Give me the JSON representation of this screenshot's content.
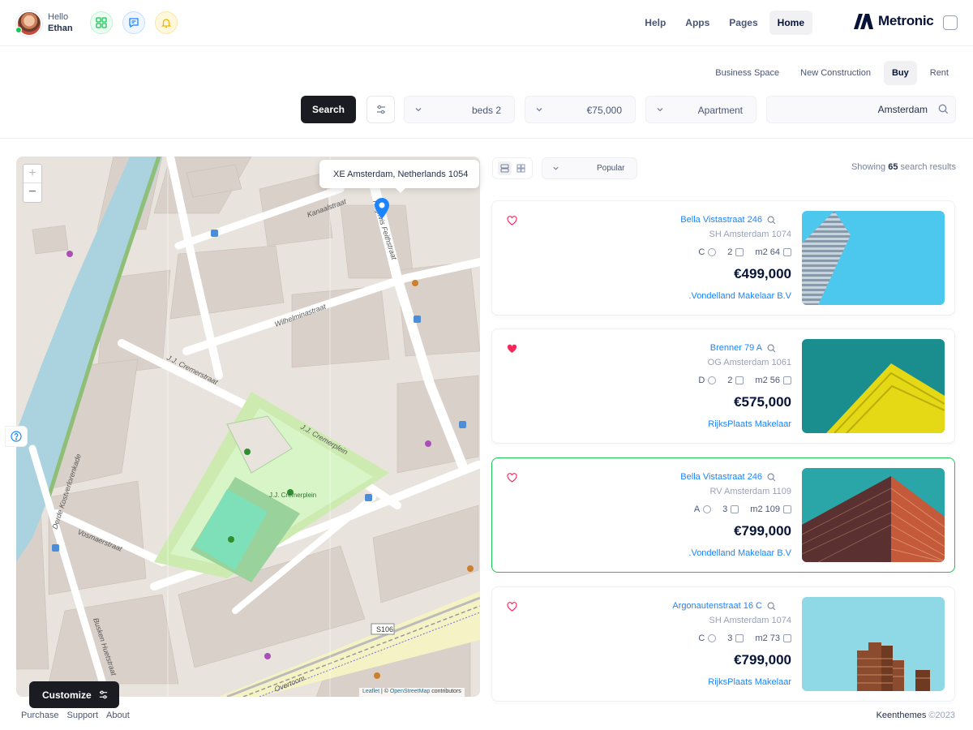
{
  "header": {
    "greeting": "Hello",
    "user_name": "Ethan",
    "nav": [
      "Help",
      "Apps",
      "Pages",
      "Home"
    ],
    "active_nav": "Home",
    "brand": "Metronic",
    "icons": [
      "apps-icon",
      "chat-icon",
      "notification-bell-icon"
    ],
    "icon_colors": [
      "#17c653",
      "#1b84ff",
      "#f6b100"
    ]
  },
  "toolbar": {
    "tabs": [
      "Business Space",
      "New Construction",
      "Buy",
      "Rent"
    ],
    "active_tab": "Buy",
    "search_label": "Search",
    "beds": "beds 2",
    "price": "€75,000",
    "type": "Apartment",
    "location": "Amsterdam"
  },
  "map": {
    "zoom_in": "+",
    "zoom_out": "−",
    "popup": "XE Amsterdam, Netherlands 1054",
    "attribution_leaflet": "Leaflet",
    "attribution_sep": " | © ",
    "attribution_osm": "OpenStreetMap",
    "attribution_rest": " contributors",
    "labels": {
      "kanaalstraat": "Kanaalstraat",
      "wilhelminastraat": "Wilhelminastraat",
      "cremerstraat": "J.J. Cremerstraat",
      "cremerplein": "J.J. Cremerplein",
      "cremerplein_park": "J.J. Cremerplein",
      "vosmaerstraat": "Vosmaerstraat",
      "overtoom": "Overtoom",
      "rhijnvis": "Rhijnvis Feithstraat",
      "kostverloren": "Derde Kostverlorenkade",
      "s106": "S106",
      "busken": "Busken Huetstraat"
    }
  },
  "list": {
    "sort": "Popular",
    "showing_prefix": "Showing",
    "count": "65",
    "showing_suffix": "search results",
    "cards": [
      {
        "title": "Bella Vistastraat 246",
        "addr": "SH Amsterdam 1074",
        "label": "C",
        "beds": "2",
        "area": "m2 64",
        "price": "€499,000",
        "agent": ".Vondelland Makelaar B.V",
        "liked": false,
        "selected": false
      },
      {
        "title": "Brenner 79 A",
        "addr": "OG Amsterdam 1061",
        "label": "D",
        "beds": "2",
        "area": "m2 56",
        "price": "€575,000",
        "agent": "RijksPlaats Makelaar",
        "liked": true,
        "selected": false
      },
      {
        "title": "Bella Vistastraat 246",
        "addr": "RV Amsterdam 1109",
        "label": "A",
        "beds": "3",
        "area": "m2 109",
        "price": "€799,000",
        "agent": ".Vondelland Makelaar B.V",
        "liked": false,
        "selected": true
      },
      {
        "title": "Argonautenstraat 16 C",
        "addr": "SH Amsterdam 1074",
        "label": "C",
        "beds": "3",
        "area": "m2 73",
        "price": "€799,000",
        "agent": "RijksPlaats Makelaar",
        "liked": false,
        "selected": false
      }
    ]
  },
  "footer": {
    "links": [
      "Purchase",
      "Support",
      "About"
    ],
    "brand": "Keenthemes",
    "year": "©2023"
  },
  "customize_label": "Customize",
  "colors": {
    "primary": "#1b84ff",
    "success": "#17c653",
    "dark": "#1b1c22",
    "danger": "#f8285a"
  }
}
